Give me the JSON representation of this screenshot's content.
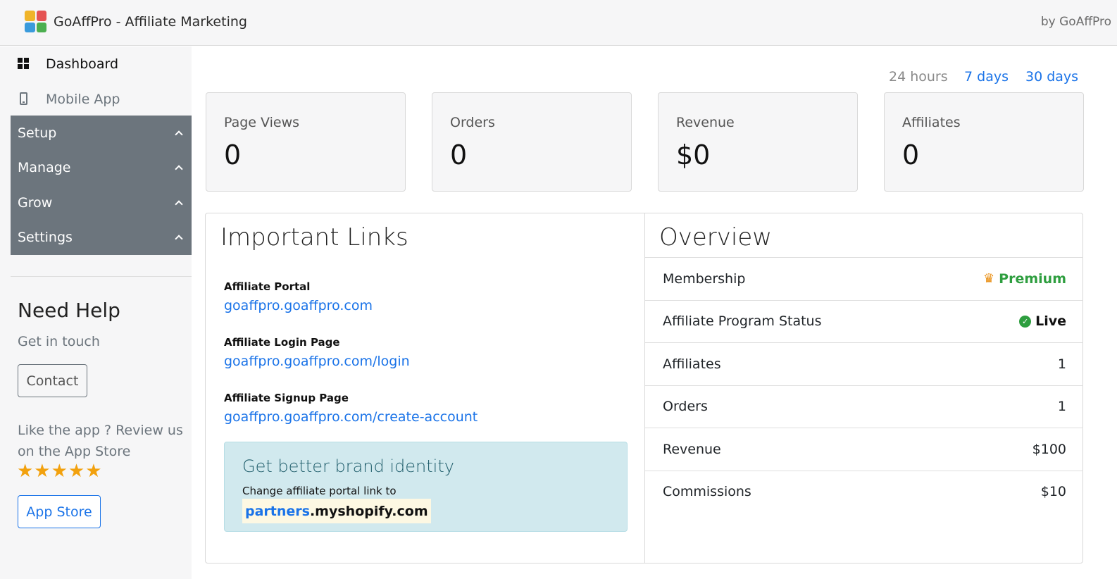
{
  "header": {
    "app_title": "GoAffPro - Affiliate Marketing",
    "by_label": "by GoAffPro"
  },
  "sidebar": {
    "dashboard_label": "Dashboard",
    "mobile_label": "Mobile App",
    "groups": [
      {
        "label": "Setup"
      },
      {
        "label": "Manage"
      },
      {
        "label": "Grow"
      },
      {
        "label": "Settings"
      }
    ],
    "help": {
      "title": "Need Help",
      "subtitle": "Get in touch",
      "contact_label": "Contact",
      "review_text": "Like the app ? Review us on the App Store",
      "stars": "★★★★★",
      "rating": 5,
      "appstore_label": "App Store"
    }
  },
  "range": {
    "options": [
      "24 hours",
      "7 days",
      "30 days"
    ],
    "selected": "24 hours"
  },
  "stats": [
    {
      "label": "Page Views",
      "value": "0"
    },
    {
      "label": "Orders",
      "value": "0"
    },
    {
      "label": "Revenue",
      "value": "$0"
    },
    {
      "label": "Affiliates",
      "value": "0"
    }
  ],
  "links": {
    "title": "Important Links",
    "items": [
      {
        "label": "Affiliate Portal",
        "url": "goaffpro.goaffpro.com"
      },
      {
        "label": "Affiliate Login Page",
        "url": "goaffpro.goaffpro.com/login"
      },
      {
        "label": "Affiliate Signup Page",
        "url": "goaffpro.goaffpro.com/create-account"
      }
    ],
    "brand": {
      "title": "Get better brand identity",
      "text": "Change affiliate portal link to",
      "domain_sub": "partners",
      "domain_rest": ".myshopify.com"
    }
  },
  "overview": {
    "title": "Overview",
    "rows": [
      {
        "label": "Membership",
        "value": "Premium"
      },
      {
        "label": "Affiliate Program Status",
        "value": "Live"
      },
      {
        "label": "Affiliates",
        "value": "1"
      },
      {
        "label": "Orders",
        "value": "1"
      },
      {
        "label": "Revenue",
        "value": "$100"
      },
      {
        "label": "Commissions",
        "value": "$10"
      }
    ]
  },
  "colors": {
    "accent": "#1a73e8",
    "sidebar_group_bg": "#6c757d",
    "premium": "#2e9e3f",
    "star": "#f2a10e",
    "brand_box_bg": "#d1e9ee"
  }
}
